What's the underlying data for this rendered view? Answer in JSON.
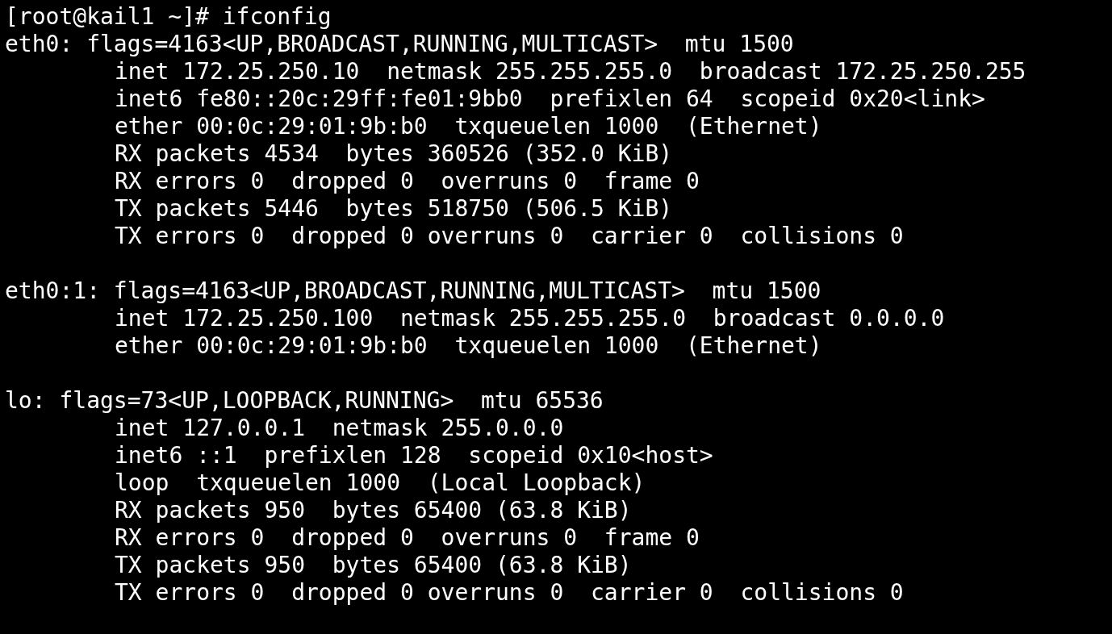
{
  "prompt": "[root@kail1 ~]# ifconfig",
  "interfaces": [
    {
      "header": "eth0: flags=4163<UP,BROADCAST,RUNNING,MULTICAST>  mtu 1500",
      "lines": [
        "inet 172.25.250.10  netmask 255.255.255.0  broadcast 172.25.250.255",
        "inet6 fe80::20c:29ff:fe01:9bb0  prefixlen 64  scopeid 0x20<link>",
        "ether 00:0c:29:01:9b:b0  txqueuelen 1000  (Ethernet)",
        "RX packets 4534  bytes 360526 (352.0 KiB)",
        "RX errors 0  dropped 0  overruns 0  frame 0",
        "TX packets 5446  bytes 518750 (506.5 KiB)",
        "TX errors 0  dropped 0 overruns 0  carrier 0  collisions 0"
      ]
    },
    {
      "header": "eth0:1: flags=4163<UP,BROADCAST,RUNNING,MULTICAST>  mtu 1500",
      "lines": [
        "inet 172.25.250.100  netmask 255.255.255.0  broadcast 0.0.0.0",
        "ether 00:0c:29:01:9b:b0  txqueuelen 1000  (Ethernet)"
      ]
    },
    {
      "header": "lo: flags=73<UP,LOOPBACK,RUNNING>  mtu 65536",
      "lines": [
        "inet 127.0.0.1  netmask 255.0.0.0",
        "inet6 ::1  prefixlen 128  scopeid 0x10<host>",
        "loop  txqueuelen 1000  (Local Loopback)",
        "RX packets 950  bytes 65400 (63.8 KiB)",
        "RX errors 0  dropped 0  overruns 0  frame 0",
        "TX packets 950  bytes 65400 (63.8 KiB)",
        "TX errors 0  dropped 0 overruns 0  carrier 0  collisions 0"
      ]
    }
  ]
}
